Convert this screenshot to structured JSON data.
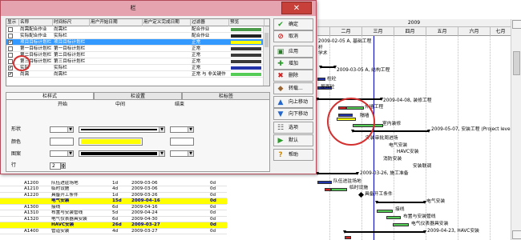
{
  "dialog": {
    "title": "栏",
    "close_icon": "close-icon",
    "columns": [
      "显示",
      "名称",
      "时间标尺",
      "用户开始日期",
      "用户定义完成日期",
      "过滤器",
      "预览"
    ],
    "rows": [
      {
        "checked": false,
        "name": "尚需配合作业",
        "timescale": "尚需栏",
        "filter": "配合作业",
        "color": "#4a9a4a"
      },
      {
        "checked": false,
        "name": "实际配合作业",
        "timescale": "实际栏",
        "filter": "配合作业",
        "color": "#222222"
      },
      {
        "checked": true,
        "name": "项目目标计划栏",
        "timescale": "项目目标计划栏",
        "filter": "正常",
        "color": "#ffff00",
        "selected": true
      },
      {
        "checked": false,
        "name": "第一目标计划栏",
        "timescale": "第一目标计划栏",
        "filter": "正常",
        "color": "#3a3a3a"
      },
      {
        "checked": false,
        "name": "第二目标计划栏",
        "timescale": "第二目标计划栏",
        "filter": "正常",
        "color": "#3a3a3a"
      },
      {
        "checked": false,
        "name": "第三目标计划栏",
        "timescale": "第三目标计划栏",
        "filter": "正常",
        "color": "#3a3a3a"
      },
      {
        "checked": true,
        "name": "实际",
        "timescale": "实际栏",
        "filter": "正常",
        "color": "#2233aa"
      },
      {
        "checked": true,
        "name": "尚需",
        "timescale": "尚需栏",
        "filter": "正常 与 非关键作",
        "color": "#55cc55"
      }
    ],
    "tabs": [
      "栏样式",
      "栏设置",
      "栏标签"
    ],
    "style_panel": {
      "col_start": "开始",
      "col_middle": "中间",
      "col_end": "结束",
      "label_shape": "形状",
      "label_color": "颜色",
      "label_pattern": "图案",
      "label_row": "行",
      "middle_color": "#ffff00",
      "row_value": "2"
    },
    "buttons": [
      {
        "label": "确定",
        "icon": "check-icon",
        "glyph": "✔",
        "color": "#2a9a2a"
      },
      {
        "label": "取消",
        "icon": "cancel-icon",
        "glyph": "⊘",
        "color": "#d02020"
      },
      {
        "label": "应用",
        "icon": "apply-icon",
        "glyph": "▣",
        "color": "#2a7a2a"
      },
      {
        "label": "增加",
        "icon": "add-icon",
        "glyph": "✚",
        "color": "#2a9a2a"
      },
      {
        "label": "删除",
        "icon": "delete-icon",
        "glyph": "✖",
        "color": "#d02020"
      },
      {
        "label": "转载...",
        "icon": "load-icon",
        "glyph": "◆",
        "color": "#996633"
      },
      {
        "label": "向上移动",
        "icon": "arrow-up-icon",
        "glyph": "▲",
        "color": "#2266cc"
      },
      {
        "label": "向下移动",
        "icon": "arrow-down-icon",
        "glyph": "▼",
        "color": "#2266cc"
      },
      {
        "label": "选项",
        "icon": "options-icon",
        "glyph": "☷",
        "color": "#555555"
      },
      {
        "label": "默认",
        "icon": "default-icon",
        "glyph": "▶",
        "color": "#2a9a2a"
      },
      {
        "label": "帮助",
        "icon": "help-icon",
        "glyph": "?",
        "color": "#cc8800"
      }
    ]
  },
  "timeline": {
    "year": "2009",
    "months": [
      "二月",
      "三月",
      "四月",
      "五月",
      "六月",
      "七月"
    ]
  },
  "gantt_labels": {
    "l1": "2009-02-05 A, 基础工程",
    "l2": "2009-03-05 A, 结构工程",
    "l3": "柱砼",
    "l4": "屋面砼",
    "l5": "2009-04-08, 装修工程",
    "l6": "外墙工程",
    "l7": "隔墙",
    "l8": "室内装修",
    "l9": "2009-05-07, 安装工程 (Project level)",
    "l10": "安装审批周进场",
    "l11": "电气安装",
    "l12": "HAVC安装",
    "l13": "消防安装",
    "l14": "安装联调",
    "l15": "2009-03-26, 施工准备",
    "l16": "队伍进驻场地",
    "l17": "临时设施",
    "l18": "具备开工条件",
    "l19": "电气安装",
    "l20": "接线",
    "l21": "布置与安装管线",
    "l22": "电气仪表器具安装",
    "l23": "2009-04-23, HAVC安装",
    "top_a": "杆",
    "top_b": "学术"
  },
  "bg_rows": [
    {
      "id": "A1200",
      "name": "队伍进驻场地",
      "dur": "1d",
      "start": "2009-03-06",
      "end": "0d"
    },
    {
      "id": "A1210",
      "name": "临时设施",
      "dur": "4d",
      "start": "2009-03-06",
      "end": "0d"
    },
    {
      "id": "A1220",
      "name": "具备开工条件",
      "dur": "1d",
      "start": "2009-03-26",
      "end": "0d"
    },
    {
      "id": "",
      "name": "电气安装",
      "dur": "15d",
      "start": "2009-04-16",
      "end": "0d",
      "summary": true
    },
    {
      "id": "A1300",
      "name": "接线",
      "dur": "6d",
      "start": "2009-04-16",
      "end": "0d"
    },
    {
      "id": "A1310",
      "name": "布置与安装管线",
      "dur": "5d",
      "start": "2009-04-24",
      "end": "0d"
    },
    {
      "id": "A1320",
      "name": "电气仪表器具安装",
      "dur": "6d",
      "start": "2009-04-30",
      "end": "0d"
    },
    {
      "id": "",
      "name": "HAVC安装",
      "dur": "26d",
      "start": "2009-03-27",
      "end": "0d",
      "summary": true
    },
    {
      "id": "A1400",
      "name": "管道安装",
      "dur": "4d",
      "start": "2009-03-27",
      "end": "0d"
    }
  ]
}
